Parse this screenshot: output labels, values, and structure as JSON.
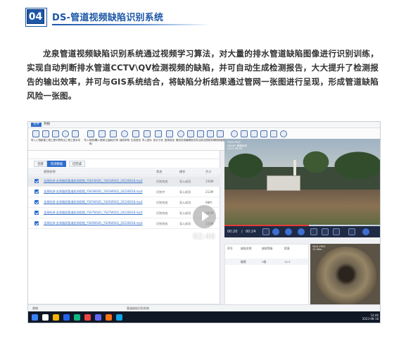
{
  "section": {
    "number": "04",
    "title": "DS-管道视频缺陷识别系统"
  },
  "paragraph": "龙泉管道视频缺陷识别系统通过视频学习算法，对大量的排水管道缺陷图像进行识别训练，实现自动判断排水管道CCTV\\QV检测视频的缺陷，并可自动生成检测报告，大大提升了检测报告的输出效率，并可与GIS系统结合，将缺陷分析结果通过管网一张图进行呈现，形成管道缺陷风险一张图。",
  "screenshot": {
    "menu": {
      "file": "文件",
      "start": "开始"
    },
    "ribbon_labels": [
      "导入工程",
      "新建工程",
      "工程列表",
      "导出工程",
      "工程另存",
      "导入视频(本地)",
      "导入视频(云)",
      "缺陷识别",
      "缺陷审核",
      "生成报告",
      "导入图片",
      "统计分析",
      "复核报告",
      "管段信息",
      "编辑报告",
      "导出报告",
      "视频剪辑",
      "视频截图",
      "系统设置",
      "模型管理",
      "帮助",
      "关于",
      "意见反馈",
      "退出"
    ],
    "tabs": [
      "全部",
      "检测数据",
      "已完成"
    ],
    "table_header": [
      "视频名称",
      "状态",
      "操作",
      "大小"
    ],
    "rows": [
      {
        "name": "龙泉检测-金泉路段管道检测视频_YS01WS01_YS01WS02_20230818.mp4",
        "c1": "识别完成",
        "c2": "导入成功",
        "c3": "156M"
      },
      {
        "name": "龙泉检测-金泉路段管道检测视频_YS03WS01_YS03WS02_20230818.mp4",
        "c1": "识别中",
        "c2": "导入成功",
        "c3": "212M"
      },
      {
        "name": "龙泉检测-金泉路段管道检测视频_YS05WS01_YS05WS02_20230818.mp4",
        "c1": "识别完成",
        "c2": "导入成功",
        "c3": "98M"
      },
      {
        "name": "龙泉检测-金泉路段管道检测视频_YS07WS01_YS07WS02_20230818.mp4",
        "c1": "识别完成",
        "c2": "导入成功",
        "c3": "187M"
      },
      {
        "name": "龙泉检测-金泉路段管道检测视频_YS09WS01_YS09WS02_20230818.mp4",
        "c1": "识别完成",
        "c2": "导入成功",
        "c3": "133M"
      }
    ],
    "footer": [
      "总 5 条",
      "已识别 4",
      "未识别 1",
      "识别中 1"
    ],
    "status_bar": [
      "就绪",
      "管道缺陷识别系统"
    ],
    "playback_time": "02:46",
    "video": {
      "current": "00:20",
      "total": "00:24",
      "overlay": [
        "YS01-YS02",
        "DN500 管道检测",
        "2023-08-18"
      ]
    },
    "defect_table": {
      "headers": [
        "序号",
        "缺陷名称",
        "缺陷等级",
        "距离"
      ],
      "row": [
        "破裂",
        "3级",
        "12.5"
      ]
    },
    "pipe_overlay": [
      "YS01-YS02",
      "12.50m"
    ],
    "clock": {
      "time": "14:46",
      "date": "2023-08-18"
    }
  }
}
